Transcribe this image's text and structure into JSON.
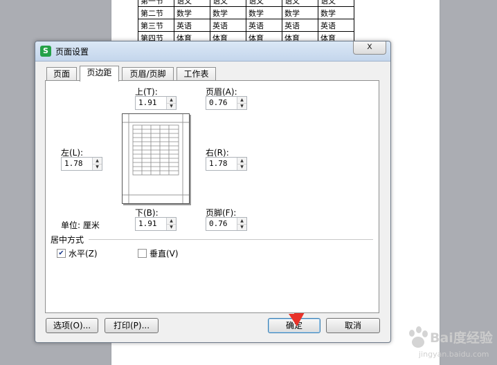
{
  "sheet": {
    "rows": [
      [
        "第一节",
        "语文",
        "语文",
        "语文",
        "语文",
        "语文"
      ],
      [
        "第二节",
        "数学",
        "数学",
        "数学",
        "数学",
        "数学"
      ],
      [
        "第三节",
        "英语",
        "英语",
        "英语",
        "英语",
        "英语"
      ],
      [
        "第四节",
        "体育",
        "体育",
        "体育",
        "体育",
        "体育"
      ]
    ]
  },
  "dialog": {
    "title": "页面设置",
    "close_label": "x",
    "tabs": [
      {
        "label": "页面"
      },
      {
        "label": "页边距"
      },
      {
        "label": "页眉/页脚"
      },
      {
        "label": "工作表"
      }
    ],
    "fields": {
      "top": {
        "label": "上(T):",
        "value": "1.91"
      },
      "header": {
        "label": "页眉(A):",
        "value": "0.76"
      },
      "left": {
        "label": "左(L):",
        "value": "1.78"
      },
      "right": {
        "label": "右(R):",
        "value": "1.78"
      },
      "bottom": {
        "label": "下(B):",
        "value": "1.91"
      },
      "footer": {
        "label": "页脚(F):",
        "value": "0.76"
      }
    },
    "unit_label": "单位: 厘米",
    "center_group": {
      "label": "居中方式",
      "horizontal": {
        "label": "水平(Z)",
        "checked": true
      },
      "vertical": {
        "label": "垂直(V)",
        "checked": false
      }
    },
    "buttons": {
      "options": "选项(O)...",
      "print": "打印(P)...",
      "ok": "确定",
      "cancel": "取消"
    }
  },
  "watermark": {
    "text": "Bai度经验",
    "url": "jingyan.baidu.com"
  },
  "colors": {
    "arrow": "#e8322a",
    "app_icon": "#24a148"
  }
}
